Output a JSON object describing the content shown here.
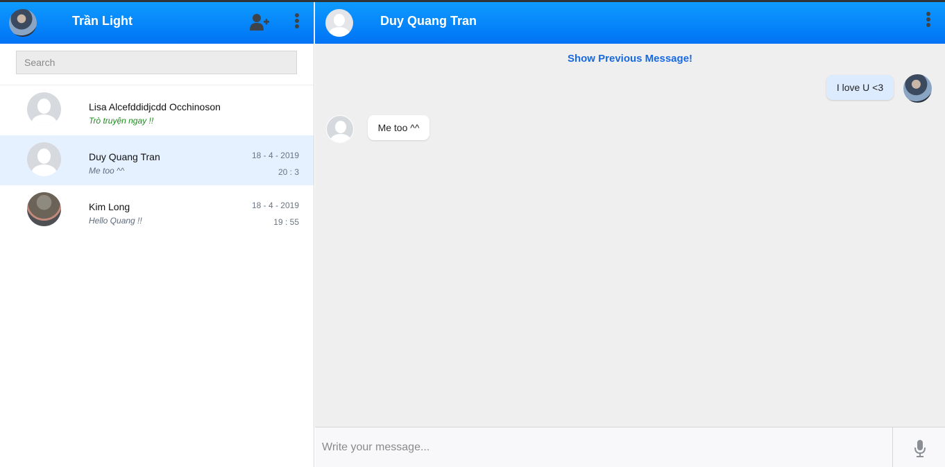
{
  "sidebar": {
    "user_name": "Trần Light",
    "search": {
      "placeholder": "Search",
      "value": ""
    },
    "conversations": [
      {
        "name": "Lisa Alcefddidjcdd Occhinoson",
        "last_message": "Trò truyện ngay !!",
        "date": "",
        "time": ""
      },
      {
        "name": "Duy Quang Tran",
        "last_message": "Me too ^^",
        "date": "18 - 4 - 2019",
        "time": "20 : 3"
      },
      {
        "name": "Kim Long",
        "last_message": "Hello Quang !!",
        "date": "18 - 4 - 2019",
        "time": "19 : 55"
      }
    ]
  },
  "chat": {
    "peer_name": "Duy Quang Tran",
    "show_previous_label": "Show Previous Message!",
    "messages": [
      {
        "direction": "outgoing",
        "text": "I love U <3"
      },
      {
        "direction": "incoming",
        "text": "Me too ^^"
      }
    ],
    "composer": {
      "placeholder": "Write your message...",
      "value": ""
    }
  },
  "icons": {
    "add_friend": "user-plus-icon",
    "menu": "more-vertical-icon",
    "mic": "microphone-icon"
  },
  "colors": {
    "header_gradient_top": "#0e9bff",
    "header_gradient_bottom": "#0073f5",
    "active_conversation": "#e6f1ff",
    "link": "#1769e0",
    "outgoing_bubble": "#ddebff"
  }
}
